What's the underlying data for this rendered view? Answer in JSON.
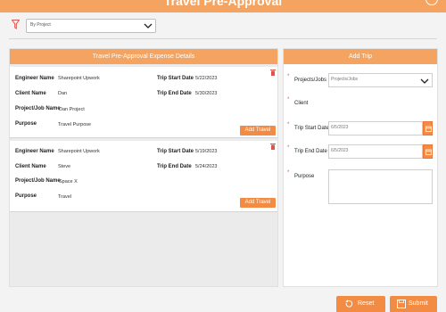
{
  "header": {
    "title": "Travel Pre-Approval"
  },
  "filter": {
    "value": "By Project"
  },
  "expense_panel": {
    "title": "Travel Pre-Approval Expense Details",
    "field_labels": {
      "engineer": "Engineer Name",
      "client": "Client Name",
      "project": "Project/Job Name",
      "purpose": "Purpose",
      "start": "Trip Start Date",
      "end": "Trip End Date"
    },
    "cards": [
      {
        "engineer": "Sharepoint Upwork",
        "client": "Dan",
        "project": "Dan Project",
        "purpose": "Travel Purpose",
        "start": "5/22/2023",
        "end": "5/30/2023",
        "button": "Add Travel"
      },
      {
        "engineer": "Sharepoint Upwork",
        "client": "Steve",
        "project": "Space X",
        "purpose": "Travel",
        "start": "5/19/2023",
        "end": "5/24/2023",
        "button": "Add Travel"
      }
    ]
  },
  "add_trip": {
    "title": "Add Trip",
    "required_mark": "*",
    "projects_label": "Projects/Jobs",
    "projects_value": "Projects/Jobs",
    "client_label": "Client",
    "start_label": "Trip Start Date",
    "start_value": "6/5/2023",
    "end_label": "Trip End Date",
    "end_value": "6/5/2023",
    "purpose_label": "Purpose"
  },
  "footer": {
    "reset": "Reset",
    "submit": "Submit"
  },
  "colors": {
    "accent": "#f4a460",
    "button": "#f28c45",
    "required": "#e0524a"
  }
}
